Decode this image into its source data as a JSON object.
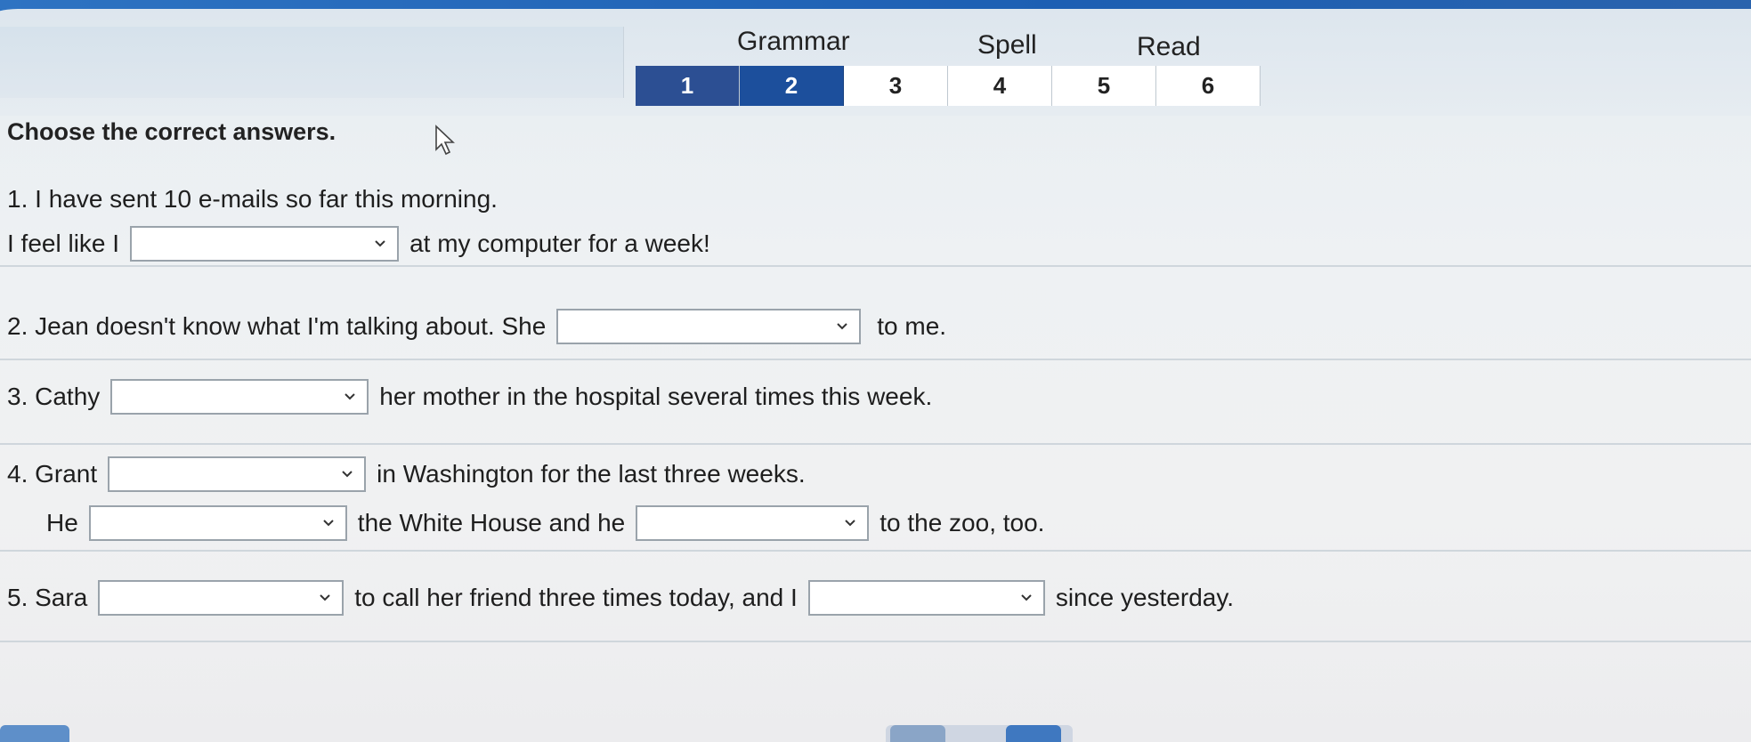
{
  "sections": {
    "grammar": "Grammar",
    "spell": "Spell",
    "read": "Read"
  },
  "steps": [
    "1",
    "2",
    "3",
    "4",
    "5",
    "6"
  ],
  "active_step": "2",
  "instruction": "Choose the correct answers.",
  "questions": {
    "q1": {
      "line1": "1. I have sent 10 e-mails so far this morning.",
      "pre": "I feel like I",
      "post": "at my computer for a week!"
    },
    "q2": {
      "pre": "2. Jean doesn't know what I'm talking about. She",
      "post": "to me."
    },
    "q3": {
      "pre": "3. Cathy",
      "post": "her mother in the hospital several times this week."
    },
    "q4": {
      "pre": "4. Grant",
      "post": "in Washington for the last three weeks.",
      "l2_pre": "He",
      "l2_mid": "the White House and he",
      "l2_post": "to the zoo, too."
    },
    "q5": {
      "pre": "5. Sara",
      "mid": "to call her friend three times today, and I",
      "post": "since yesterday."
    }
  },
  "icons": {
    "dropdown": "chevron-down-icon",
    "cursor": "mouse-pointer-icon"
  },
  "colors": {
    "topbar": "#1d5fb3",
    "active_step": "#1c4f9c",
    "background": "#eef1f3"
  }
}
